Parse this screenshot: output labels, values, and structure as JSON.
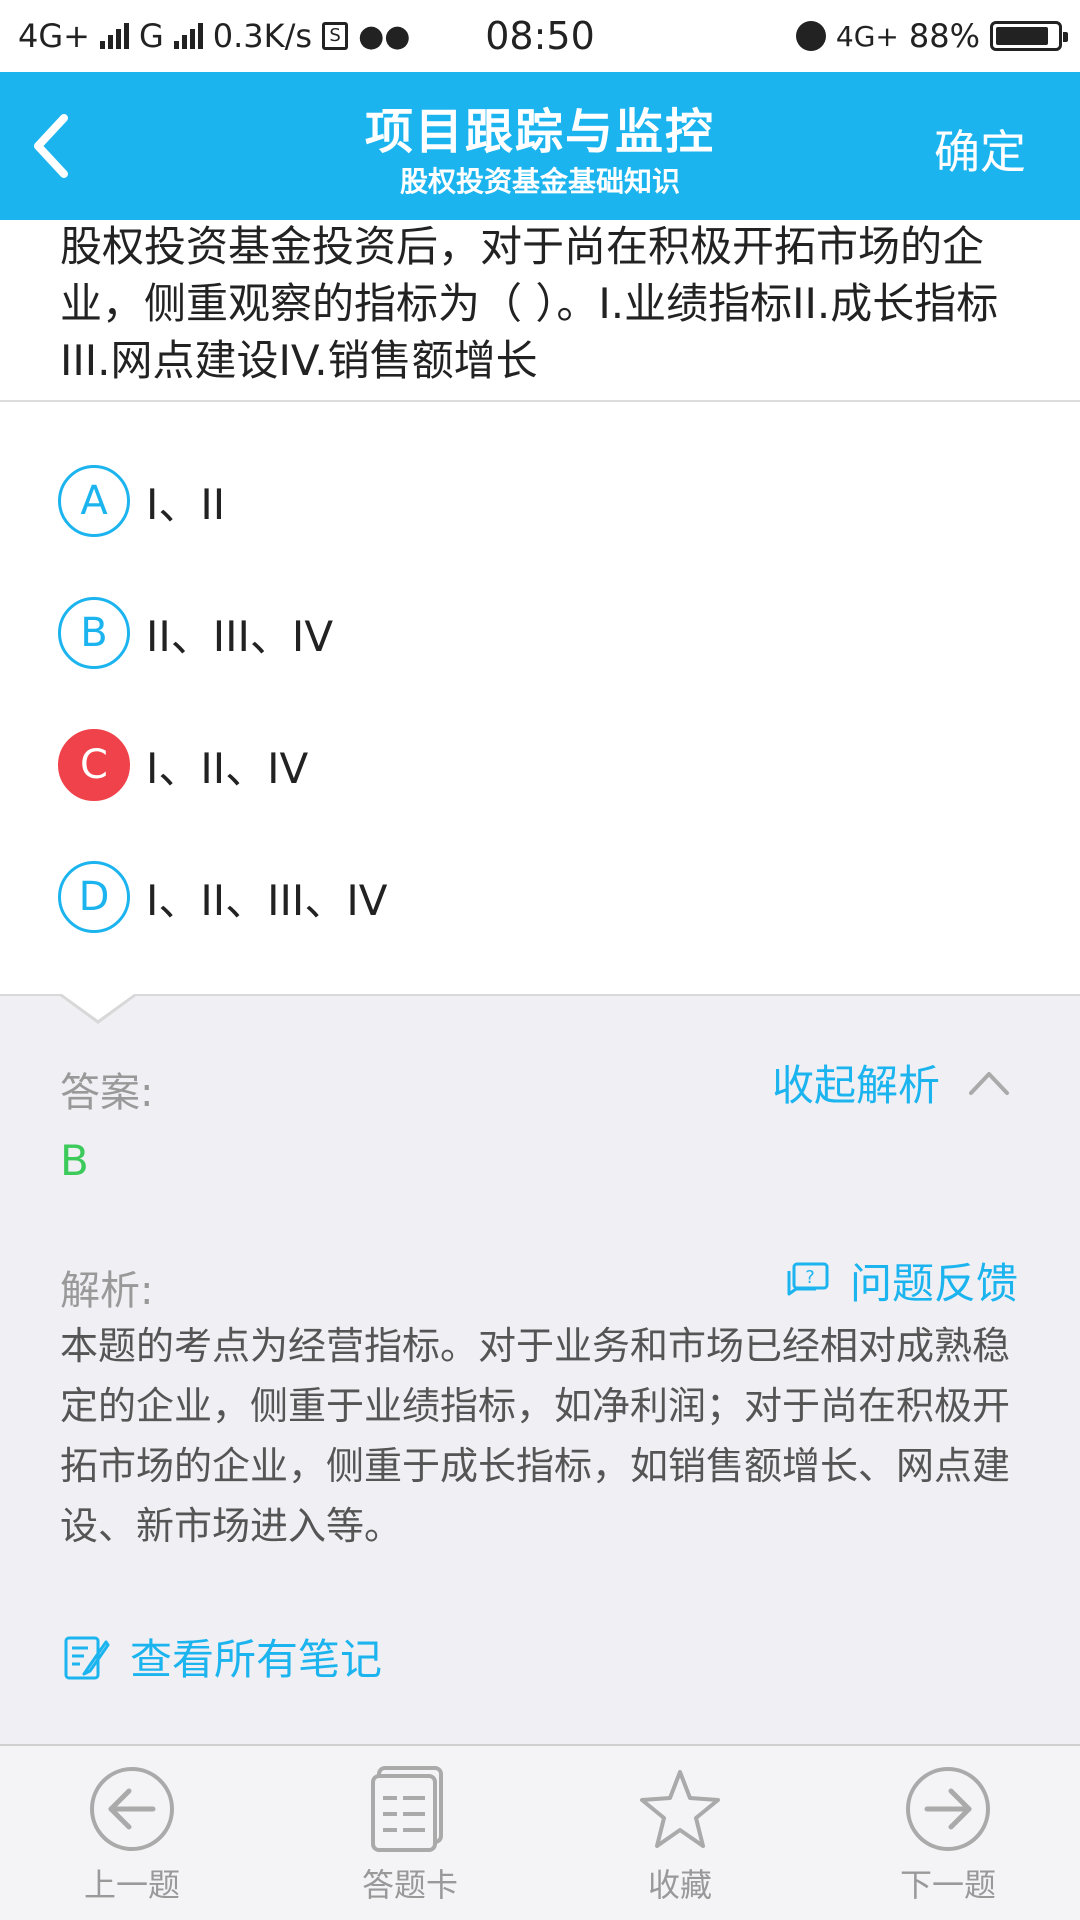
{
  "status_bar": {
    "network1": "4G+",
    "network2": "G",
    "speed": "0.3K/s",
    "time": "08:50",
    "network3": "4G+",
    "battery": "88%",
    "battery_level": 0.88
  },
  "header": {
    "title": "项目跟踪与监控",
    "subtitle": "股权投资基金基础知识",
    "confirm_label": "确定",
    "bg_color": "#1cb4ef"
  },
  "question": {
    "text": "股权投资基金投资后，对于尚在积极开拓市场的企业，侧重观察的指标为（ ）。I.业绩指标II.成长指标III.网点建设IV.销售额增长"
  },
  "options": [
    {
      "letter": "A",
      "text": "I、II",
      "state": "normal"
    },
    {
      "letter": "B",
      "text": "II、III、IV",
      "state": "normal"
    },
    {
      "letter": "C",
      "text": "I、II、IV",
      "state": "wrong-selected"
    },
    {
      "letter": "D",
      "text": "I、II、III、IV",
      "state": "normal"
    }
  ],
  "analysis": {
    "answer_label": "答案:",
    "answer_value": "B",
    "collapse_label": "收起解析",
    "analysis_label": "解析:",
    "feedback_label": "问题反馈",
    "text": "本题的考点为经营指标。对于业务和市场已经相对成熟稳定的企业，侧重于业绩指标，如净利润；对于尚在积极开拓市场的企业，侧重于成长指标，如销售额增长、网点建设、新市场进入等。",
    "notes_label": "查看所有笔记"
  },
  "bottom_bar": {
    "tabs": [
      {
        "label": "上一题",
        "icon": "arrow-left-circle-icon"
      },
      {
        "label": "答题卡",
        "icon": "answer-card-icon"
      },
      {
        "label": "收藏",
        "icon": "star-icon"
      },
      {
        "label": "下一题",
        "icon": "arrow-right-circle-icon"
      }
    ]
  },
  "colors": {
    "accent": "#1cb4ef",
    "wrong": "#f0424a",
    "correct": "#3ccb5a"
  }
}
